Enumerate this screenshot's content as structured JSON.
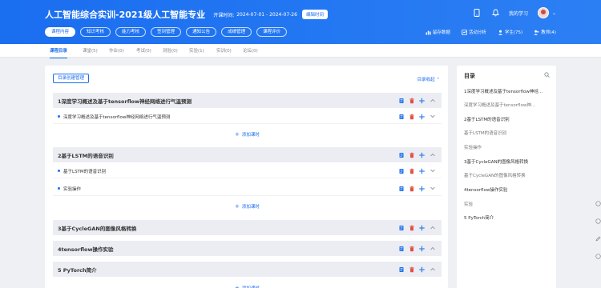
{
  "header": {
    "title": "人工智能综合实训-2021级人工智能专业",
    "date_label": "开课时间:",
    "date_value": "2024-07-01 - 2024-07-26",
    "edit_time": "编辑时间",
    "my_learning": "我的学习"
  },
  "nav": {
    "pills": [
      "课程内容",
      "知识考核",
      "能力考核",
      "签到管理",
      "通知公告",
      "成绩管理",
      "课程评价"
    ],
    "active_index": 0
  },
  "stats": {
    "backend": "留存数据",
    "activity": "活动分析",
    "students": "学生(75)",
    "teachers": "教师(4)"
  },
  "subtabs": [
    "课程目录",
    "课堂(5)",
    "作业(0)",
    "考试(0)",
    "测验(0)",
    "实验(1)",
    "实训(0)",
    "论坛(0)"
  ],
  "toolbar": {
    "manage": "目录创建管理",
    "collapse": "目录收起"
  },
  "chapters": [
    {
      "title": "1深度学习概述及基于tensorflow神经网络进行气温预测",
      "lessons": [
        "深度学习概述及基于tensorflow神经网络进行气温预测"
      ]
    },
    {
      "title": "2基于LSTM的语音识别",
      "lessons": [
        "基于LSTM的语音识别",
        "实验操作"
      ]
    },
    {
      "title": "3基于CycleGAN的图像风格转换",
      "lessons": []
    },
    {
      "title": "4tensorflow操作实验",
      "lessons": []
    },
    {
      "title": "5 PyTorch简介",
      "lessons": []
    }
  ],
  "add_lesson": "添加课时",
  "sidebar": {
    "heading": "目录",
    "items": [
      {
        "kind": "chapter",
        "text": "1深度学习概述及基于tensorflow神经..."
      },
      {
        "kind": "lesson",
        "text": "深度学习概述及基于tensorflow神..."
      },
      {
        "kind": "chapter",
        "text": "2基于LSTM的语音识别"
      },
      {
        "kind": "lesson",
        "text": "基于LSTM的语音识别"
      },
      {
        "kind": "lesson",
        "text": "实验操作"
      },
      {
        "kind": "chapter",
        "text": "3基于CycleGAN的图像风格转换"
      },
      {
        "kind": "lesson",
        "text": "基于CycleGAN的图像风格转换"
      },
      {
        "kind": "chapter",
        "text": "4tensorflow操作实验"
      },
      {
        "kind": "lesson",
        "text": "实验"
      },
      {
        "kind": "chapter",
        "text": "5 PyTorch简介"
      }
    ]
  },
  "colors": {
    "brand": "#1a6ef0",
    "delete": "#e0504a"
  }
}
